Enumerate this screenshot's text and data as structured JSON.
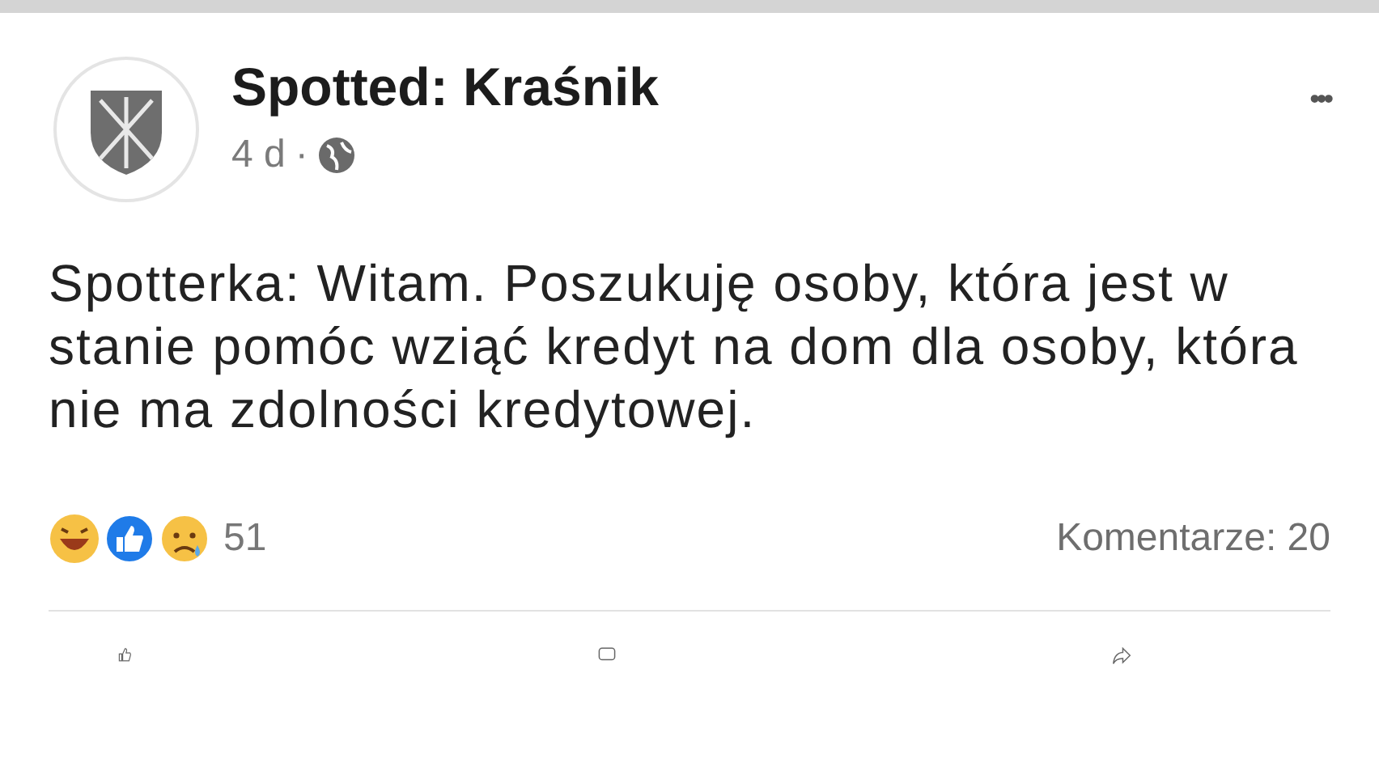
{
  "post": {
    "page_name": "Spotted: Kraśnik",
    "time": "4 d",
    "separator": "·",
    "menu": "•••",
    "text": "Spotterka: Witam. Poszukuję osoby, która jest w stanie pomóc wziąć kredyt na dom dla osoby, która nie ma zdolności kredytowej."
  },
  "reactions": {
    "count": "51"
  },
  "comments": "Komentarze: 20"
}
